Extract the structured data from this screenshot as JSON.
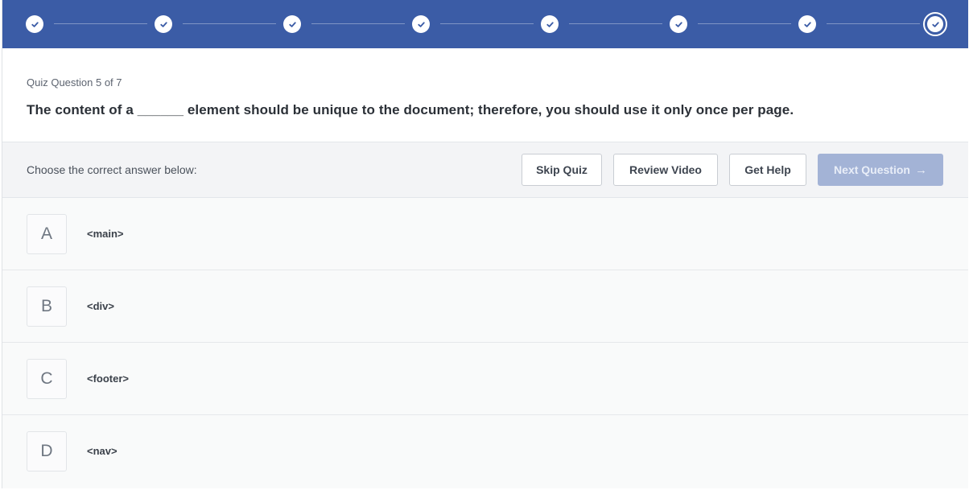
{
  "progress": {
    "total_steps": 8,
    "completed_steps": 7,
    "current_step": 8,
    "step_icon": "check-icon"
  },
  "question": {
    "counter": "Quiz Question 5 of 7",
    "text": "The content of a ______ element should be unique to the document; therefore, you should use it only once per page."
  },
  "toolbar": {
    "instruction": "Choose the correct answer below:",
    "skip_label": "Skip Quiz",
    "review_label": "Review Video",
    "help_label": "Get Help",
    "next_label": "Next Question",
    "next_icon": "arrow-right-icon"
  },
  "answers": [
    {
      "letter": "A",
      "text": "<main>"
    },
    {
      "letter": "B",
      "text": "<div>"
    },
    {
      "letter": "C",
      "text": "<footer>"
    },
    {
      "letter": "D",
      "text": "<nav>"
    }
  ],
  "colors": {
    "brand_blue": "#3b5ca6",
    "disabled_button": "#a3b3d6",
    "toolbar_bg": "#f3f4f6"
  }
}
